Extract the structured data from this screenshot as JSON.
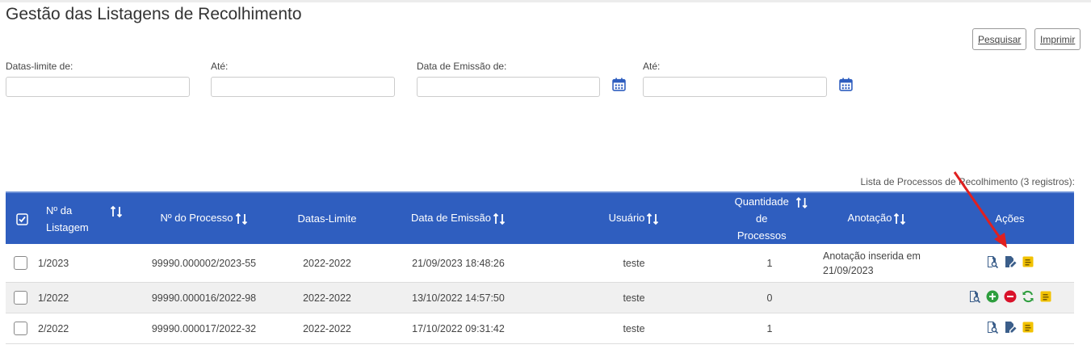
{
  "page": {
    "title": "Gestão das Listagens de Recolhimento"
  },
  "buttons": {
    "search": "Pesquisar",
    "print": "Imprimir"
  },
  "filters": {
    "deadline_from_label": "Datas-limite de:",
    "deadline_to_label": "Até:",
    "emission_from_label": "Data de Emissão de:",
    "emission_to_label": "Até:",
    "deadline_from_value": "",
    "deadline_to_value": "",
    "emission_from_value": "",
    "emission_to_value": ""
  },
  "table": {
    "caption": "Lista de Processos de Recolhimento (3 registros):",
    "headers": {
      "listing_line1": "Nº da",
      "listing_line2": "Listagem",
      "process": "Nº do Processo",
      "deadlines": "Datas-Limite",
      "emission": "Data de Emissão",
      "user": "Usuário",
      "qty_line1": "Quantidade",
      "qty_line2": "de Processos",
      "note": "Anotação",
      "actions": "Ações"
    },
    "rows": [
      {
        "listing": "1/2023",
        "process": "99990.000002/2023-55",
        "deadlines": "2022-2022",
        "emission": "21/09/2023 18:48:26",
        "user": "teste",
        "qty": "1",
        "note_line1": "Anotação inserida em",
        "note_line2": "21/09/2023",
        "actions": [
          "view-icon",
          "edit-icon",
          "note-icon"
        ]
      },
      {
        "listing": "1/2022",
        "process": "99990.000016/2022-98",
        "deadlines": "2022-2022",
        "emission": "13/10/2022 14:57:50",
        "user": "teste",
        "qty": "0",
        "note_line1": "",
        "note_line2": "",
        "actions": [
          "view-icon",
          "add-icon",
          "remove-icon",
          "refresh-icon",
          "note-icon"
        ]
      },
      {
        "listing": "2/2022",
        "process": "99990.000017/2022-32",
        "deadlines": "2022-2022",
        "emission": "17/10/2022 09:31:42",
        "user": "teste",
        "qty": "1",
        "note_line1": "",
        "note_line2": "",
        "actions": [
          "view-icon",
          "edit-icon",
          "note-icon"
        ]
      }
    ]
  },
  "colors": {
    "header_bg": "#2f5ebf",
    "alt_row": "#f0f0f0",
    "annotation_arrow": "#e02020",
    "calendar_icon": "#2f5ebf"
  }
}
